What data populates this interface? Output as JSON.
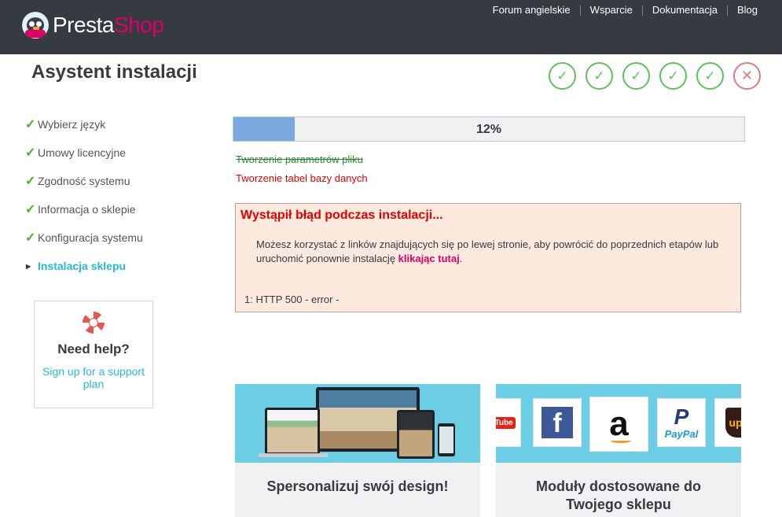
{
  "brand": {
    "logo_white": "Presta",
    "logo_pink": "Shop"
  },
  "topnav": [
    "Forum angielskie",
    "Wsparcie",
    "Dokumentacja",
    "Blog"
  ],
  "header": {
    "title": "Asystent instalacji"
  },
  "step_status": [
    "done",
    "done",
    "done",
    "done",
    "done",
    "error"
  ],
  "sidebar": {
    "items": [
      {
        "label": "Wybierz język",
        "state": "done"
      },
      {
        "label": "Umowy licencyjne",
        "state": "done"
      },
      {
        "label": "Zgodność systemu",
        "state": "done"
      },
      {
        "label": "Informacja o sklepie",
        "state": "done"
      },
      {
        "label": "Konfiguracja systemu",
        "state": "done"
      },
      {
        "label": "Instalacja sklepu",
        "state": "active"
      }
    ]
  },
  "help": {
    "title": "Need help?",
    "link": "Sign up for a support plan"
  },
  "progress": {
    "percent": 12,
    "label": "12%"
  },
  "tasks": {
    "done": "Tworzenie parametrów pliku",
    "failed": "Tworzenie tabel bazy danych"
  },
  "error": {
    "title": "Wystąpił błąd podczas instalacji...",
    "message_before": "Możesz korzystać z linków znajdujących się po lewej stronie, aby powrócić do poprzednich etapów lub uruchomić ponownie instalację ",
    "message_link": "klikając tutaj",
    "message_after": ".",
    "code": "1: HTTP 500 - error -"
  },
  "cards": [
    {
      "caption": "Spersonalizuj swój design!"
    },
    {
      "caption": "Moduły dostosowane do Twojego sklepu"
    }
  ],
  "card2_logos": {
    "youtube": "YouTube",
    "paypal": "PayPal",
    "ups": "ups"
  },
  "colors": {
    "topbar": "#363a41",
    "brand_pink": "#df0067",
    "accent": "#25b9d7",
    "success": "#5cc35b",
    "error": "#e50000"
  }
}
